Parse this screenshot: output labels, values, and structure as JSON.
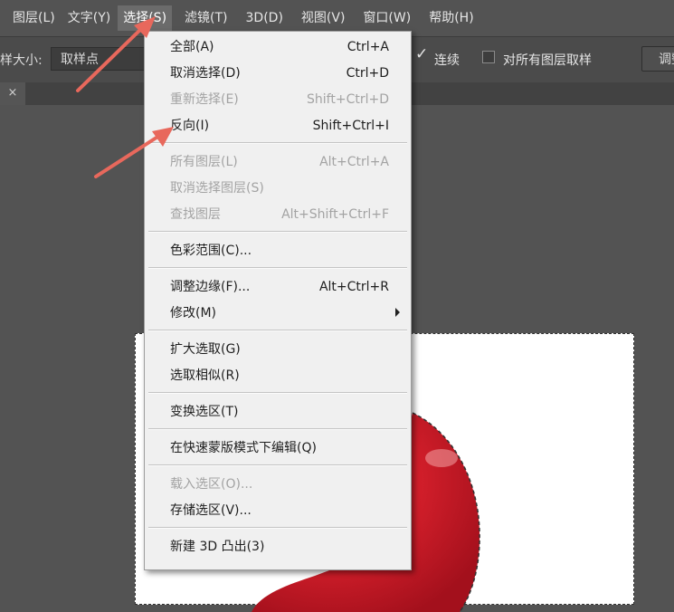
{
  "menubar": {
    "items": [
      {
        "label": "图层(L)"
      },
      {
        "label": "文字(Y)"
      },
      {
        "label": "选择(S)",
        "active": true
      },
      {
        "label": "滤镜(T)"
      },
      {
        "label": "3D(D)"
      },
      {
        "label": "视图(V)"
      },
      {
        "label": "窗口(W)"
      },
      {
        "label": "帮助(H)"
      }
    ]
  },
  "options": {
    "sample_size_label": "样大小:",
    "sample_size_value": "取样点",
    "contiguous_label": "连续",
    "contiguous_checked": true,
    "all_layers_label": "对所有图层取样",
    "all_layers_checked": false,
    "refine_button": "调整"
  },
  "tabbar": {
    "close_glyph": "×"
  },
  "select_menu": {
    "items": [
      {
        "label": "全部(A)",
        "shortcut": "Ctrl+A",
        "disabled": false
      },
      {
        "label": "取消选择(D)",
        "shortcut": "Ctrl+D",
        "disabled": false
      },
      {
        "label": "重新选择(E)",
        "shortcut": "Shift+Ctrl+D",
        "disabled": true
      },
      {
        "label": "反向(I)",
        "shortcut": "Shift+Ctrl+I",
        "disabled": false
      },
      {
        "label": "所有图层(L)",
        "shortcut": "Alt+Ctrl+A",
        "disabled": true
      },
      {
        "label": "取消选择图层(S)",
        "shortcut": "",
        "disabled": true
      },
      {
        "label": "查找图层",
        "shortcut": "Alt+Shift+Ctrl+F",
        "disabled": true
      },
      {
        "label": "色彩范围(C)...",
        "shortcut": "",
        "disabled": false
      },
      {
        "label": "调整边缘(F)...",
        "shortcut": "Alt+Ctrl+R",
        "disabled": false
      },
      {
        "label": "修改(M)",
        "shortcut": "",
        "disabled": false,
        "submenu": true
      },
      {
        "label": "扩大选取(G)",
        "shortcut": "",
        "disabled": false
      },
      {
        "label": "选取相似(R)",
        "shortcut": "",
        "disabled": false
      },
      {
        "label": "变换选区(T)",
        "shortcut": "",
        "disabled": false
      },
      {
        "label": "在快速蒙版模式下编辑(Q)",
        "shortcut": "",
        "disabled": false
      },
      {
        "label": "载入选区(O)...",
        "shortcut": "",
        "disabled": true
      },
      {
        "label": "存储选区(V)...",
        "shortcut": "",
        "disabled": false
      },
      {
        "label": "新建 3D 凸出(3)",
        "shortcut": "",
        "disabled": false
      }
    ]
  },
  "colors": {
    "app_bg": "#535353",
    "menu_bg": "#f0f0f0",
    "annotation_arrow": "#e8685c",
    "apple_red": "#d8202c"
  },
  "icons": [
    "close-icon",
    "checkbox-checked-icon",
    "submenu-arrow-icon",
    "annotation-arrow-icon"
  ]
}
